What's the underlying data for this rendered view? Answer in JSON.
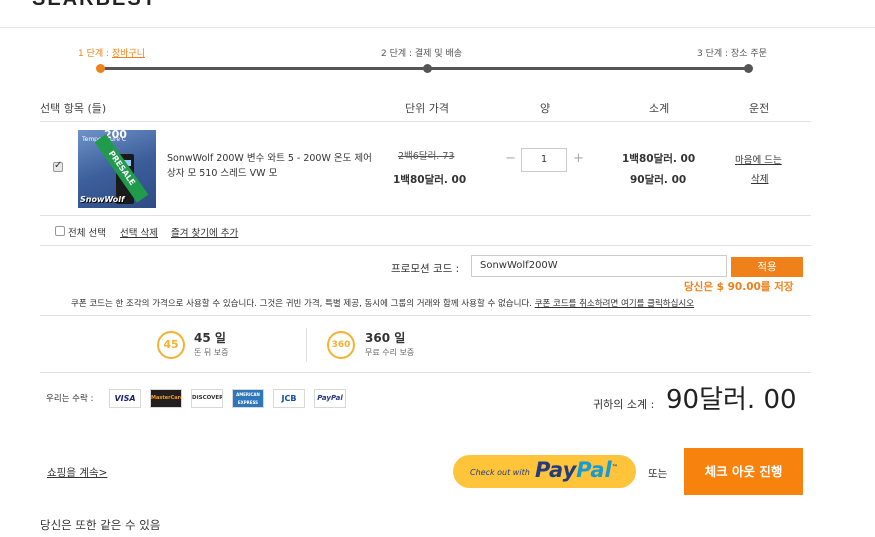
{
  "header": {
    "logo": "SEARBEST"
  },
  "steps": [
    {
      "label": "1 단계 : ",
      "name": "장바구니",
      "active": true
    },
    {
      "label": "2 단계 : 결제 및 배송",
      "active": false
    },
    {
      "label": "3 단계 : 장소 주문",
      "active": false
    }
  ],
  "table": {
    "headers": {
      "item": "선택 항목 (들)",
      "price": "단위 가격",
      "qty": "양",
      "subtotal": "소계",
      "action": "운전"
    }
  },
  "product": {
    "image_brand": "SnowWolf",
    "image_text": "Temperature C",
    "image_num": "200",
    "badge": "PRESALE",
    "name": "SonwWolf 200W 변수 와트 5 - 200W 온도 제어 상자 모 510 스레드 VW 모",
    "old_price": "2백6달러. 73",
    "new_price": "1백80달러. 00",
    "qty_minus": "−",
    "qty": "1",
    "qty_plus": "+",
    "subtotal": "1백80달러. 00",
    "saving": "90달러. 00",
    "action_favorite": "마음에 드는",
    "action_delete": "삭제"
  },
  "selection": {
    "select_all": "전체 선택",
    "delete_selected": "선택 삭제",
    "add_favorites": "즐겨 찾기에 추가"
  },
  "promo": {
    "label": "프로모션 코드 :",
    "value": "SonwWolf200W",
    "apply": "적용",
    "saving": "당신은 $ 90.00를 저장",
    "note": "쿠폰 코드는 한 조각의 가격으로 사용할 수 있습니다. 그것은 귀빈 가격, 특별 제공, 동시에 그룹의 거래와 함께 사용할 수 없습니다.",
    "cancel": "쿠폰 코드를 취소하려면 여기를 클릭하십시오"
  },
  "guarantees": [
    {
      "badge": "45",
      "title": "45 일",
      "sub": "돈 뒤 보증"
    },
    {
      "badge": "360",
      "title": "360 일",
      "sub": "무료 수리 보증"
    }
  ],
  "payments": {
    "label": "우리는 수락 :",
    "cards": [
      "VISA",
      "MasterCard",
      "DISCOVER",
      "AMERICAN EXPRESS",
      "JCB",
      "PayPal"
    ]
  },
  "total": {
    "label": "귀하의 소계 :",
    "value": "90달러. 00"
  },
  "bottom": {
    "continue": "쇼핑을 계속>",
    "paypal_prefix": "Check out with",
    "paypal_pay": "Pay",
    "paypal_pal": "Pal",
    "or": "또는",
    "checkout": "체크 아웃 진행",
    "also": "당신은 또한 같은 수 있음"
  },
  "colors": {
    "accent": "#f08019",
    "badge": "#f4b233",
    "paypal": "#ffc439"
  }
}
